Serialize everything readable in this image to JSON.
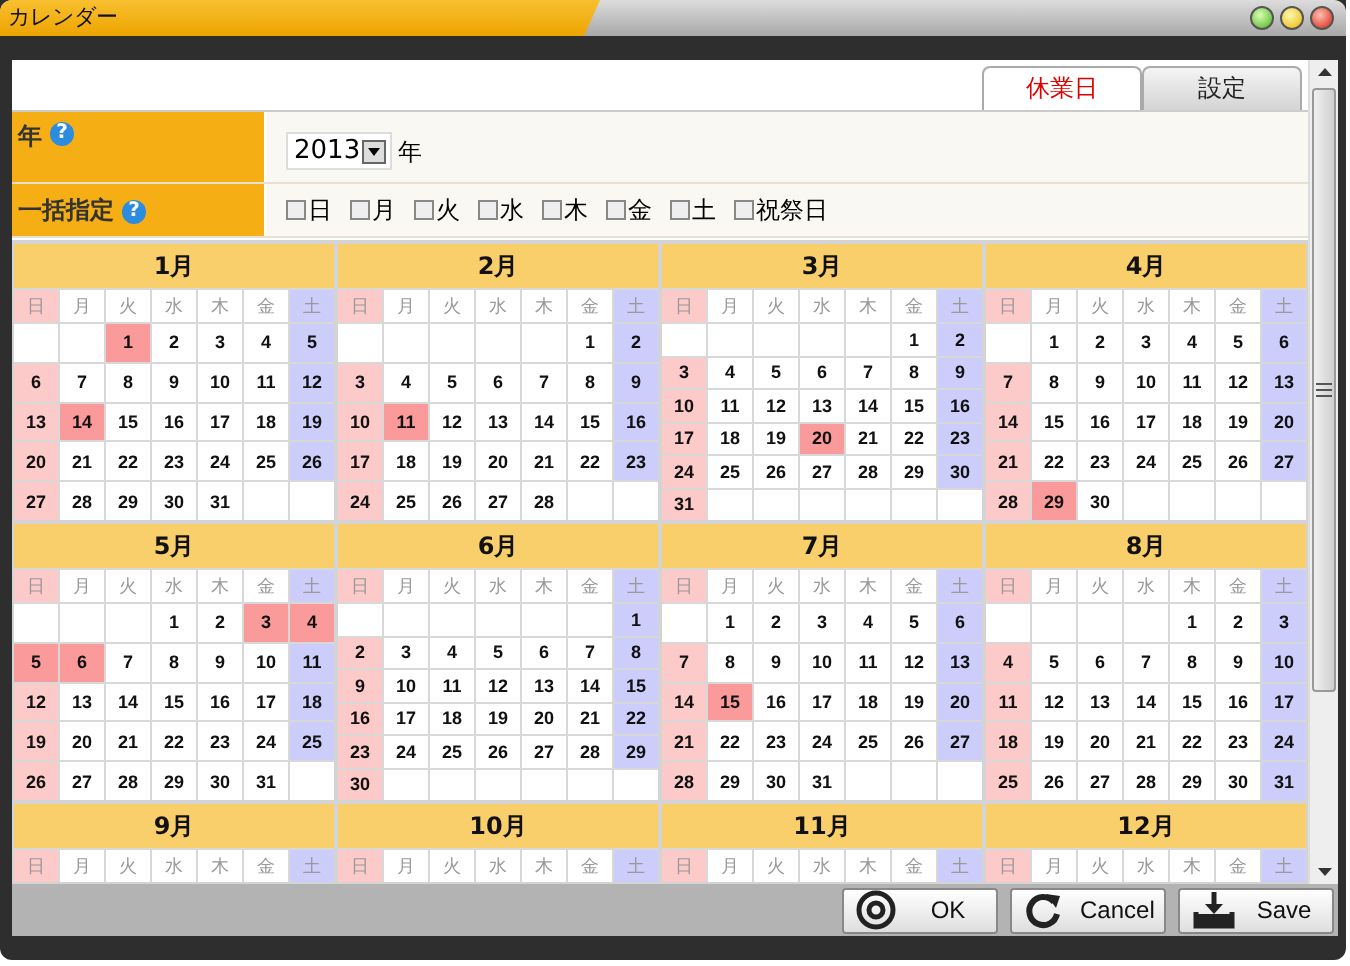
{
  "window": {
    "title": "カレンダー"
  },
  "tabs": [
    {
      "label": "休業日",
      "selected": true
    },
    {
      "label": "設定",
      "selected": false
    }
  ],
  "form": {
    "year": {
      "label": "年",
      "help": "?",
      "value": "2013",
      "unit": "年"
    },
    "bulk": {
      "label": "一括指定",
      "help": "?",
      "options": [
        {
          "label": "日",
          "checked": false
        },
        {
          "label": "月",
          "checked": false
        },
        {
          "label": "火",
          "checked": false
        },
        {
          "label": "水",
          "checked": false
        },
        {
          "label": "木",
          "checked": false
        },
        {
          "label": "金",
          "checked": false
        },
        {
          "label": "土",
          "checked": false
        },
        {
          "label": "祝祭日",
          "checked": false
        }
      ]
    }
  },
  "months": [
    {
      "title": "1月",
      "weekdays": [
        "日",
        "月",
        "火",
        "水",
        "木",
        "金",
        "土"
      ],
      "weeks": [
        [
          {
            "day": "1",
            "holiday": true
          },
          "2",
          "3",
          "4",
          "5"
        ],
        [
          "6",
          "7",
          "8",
          "9",
          "10",
          "11",
          "12"
        ],
        [
          "13",
          {
            "day": "14",
            "holiday": true
          },
          "15",
          "16",
          "17",
          "18",
          "19"
        ],
        [
          "20",
          "21",
          "22",
          "23",
          "24",
          "25",
          "26"
        ],
        [
          "27",
          "28",
          "29",
          "30",
          "31"
        ]
      ]
    },
    {
      "title": "2月",
      "weekdays": [
        "日",
        "月",
        "火",
        "水",
        "木",
        "金",
        "土"
      ],
      "weeks": [
        [
          "1",
          "2"
        ],
        [
          "3",
          "4",
          "5",
          "6",
          "7",
          "8",
          "9"
        ],
        [
          "10",
          {
            "day": "11",
            "holiday": true
          },
          "12",
          "13",
          "14",
          "15",
          "16"
        ],
        [
          "17",
          "18",
          "19",
          "20",
          "21",
          "22",
          "23"
        ],
        [
          "24",
          "25",
          "26",
          "27",
          "28"
        ]
      ]
    },
    {
      "title": "3月",
      "weekdays": [
        "日",
        "月",
        "火",
        "水",
        "木",
        "金",
        "土"
      ],
      "weeks": [
        [
          "1",
          "2"
        ],
        [
          "3",
          "4",
          "5",
          "6",
          "7",
          "8",
          "9"
        ],
        [
          "10",
          "11",
          "12",
          "13",
          "14",
          "15",
          "16"
        ],
        [
          "17",
          "18",
          "19",
          {
            "day": "20",
            "holiday": true
          },
          "21",
          "22",
          "23"
        ],
        [
          "24",
          "25",
          "26",
          "27",
          "28",
          "29",
          "30"
        ],
        [
          "31"
        ]
      ]
    },
    {
      "title": "4月",
      "weekdays": [
        "日",
        "月",
        "火",
        "水",
        "木",
        "金",
        "土"
      ],
      "weeks": [
        [
          "1",
          "2",
          "3",
          "4",
          "5",
          "6"
        ],
        [
          "7",
          "8",
          "9",
          "10",
          "11",
          "12",
          "13"
        ],
        [
          "14",
          "15",
          "16",
          "17",
          "18",
          "19",
          "20"
        ],
        [
          "21",
          "22",
          "23",
          "24",
          "25",
          "26",
          "27"
        ],
        [
          "28",
          {
            "day": "29",
            "holiday": true
          },
          "30"
        ]
      ]
    },
    {
      "title": "5月",
      "weekdays": [
        "日",
        "月",
        "火",
        "水",
        "木",
        "金",
        "土"
      ],
      "weeks": [
        [
          "1",
          "2",
          {
            "day": "3",
            "holiday": true
          },
          {
            "day": "4",
            "holiday": true
          }
        ],
        [
          {
            "day": "5",
            "holiday": true
          },
          {
            "day": "6",
            "holiday": true
          },
          "7",
          "8",
          "9",
          "10",
          "11"
        ],
        [
          "12",
          "13",
          "14",
          "15",
          "16",
          "17",
          "18"
        ],
        [
          "19",
          "20",
          "21",
          "22",
          "23",
          "24",
          "25"
        ],
        [
          "26",
          "27",
          "28",
          "29",
          "30",
          "31"
        ]
      ]
    },
    {
      "title": "6月",
      "weekdays": [
        "日",
        "月",
        "火",
        "水",
        "木",
        "金",
        "土"
      ],
      "weeks": [
        [
          "1"
        ],
        [
          "2",
          "3",
          "4",
          "5",
          "6",
          "7",
          "8"
        ],
        [
          "9",
          "10",
          "11",
          "12",
          "13",
          "14",
          "15"
        ],
        [
          "16",
          "17",
          "18",
          "19",
          "20",
          "21",
          "22"
        ],
        [
          "23",
          "24",
          "25",
          "26",
          "27",
          "28",
          "29"
        ],
        [
          "30"
        ]
      ]
    },
    {
      "title": "7月",
      "weekdays": [
        "日",
        "月",
        "火",
        "水",
        "木",
        "金",
        "土"
      ],
      "weeks": [
        [
          "1",
          "2",
          "3",
          "4",
          "5",
          "6"
        ],
        [
          "7",
          "8",
          "9",
          "10",
          "11",
          "12",
          "13"
        ],
        [
          "14",
          {
            "day": "15",
            "holiday": true
          },
          "16",
          "17",
          "18",
          "19",
          "20"
        ],
        [
          "21",
          "22",
          "23",
          "24",
          "25",
          "26",
          "27"
        ],
        [
          "28",
          "29",
          "30",
          "31"
        ]
      ]
    },
    {
      "title": "8月",
      "weekdays": [
        "日",
        "月",
        "火",
        "水",
        "木",
        "金",
        "土"
      ],
      "weeks": [
        [
          "1",
          "2",
          "3"
        ],
        [
          "4",
          "5",
          "6",
          "7",
          "8",
          "9",
          "10"
        ],
        [
          "11",
          "12",
          "13",
          "14",
          "15",
          "16",
          "17"
        ],
        [
          "18",
          "19",
          "20",
          "21",
          "22",
          "23",
          "24"
        ],
        [
          "25",
          "26",
          "27",
          "28",
          "29",
          "30",
          "31"
        ]
      ]
    },
    {
      "title": "9月",
      "weekdays": [
        "日",
        "月",
        "火",
        "水",
        "木",
        "金",
        "土"
      ]
    },
    {
      "title": "10月",
      "weekdays": [
        "日",
        "月",
        "火",
        "水",
        "木",
        "金",
        "土"
      ]
    },
    {
      "title": "11月",
      "weekdays": [
        "日",
        "月",
        "火",
        "水",
        "木",
        "金",
        "土"
      ]
    },
    {
      "title": "12月",
      "weekdays": [
        "日",
        "月",
        "火",
        "水",
        "木",
        "金",
        "土"
      ]
    }
  ],
  "buttons": [
    {
      "label": "OK",
      "kind": "ok"
    },
    {
      "label": "Cancel",
      "kind": "cancel"
    },
    {
      "label": "Save",
      "kind": "save"
    }
  ]
}
